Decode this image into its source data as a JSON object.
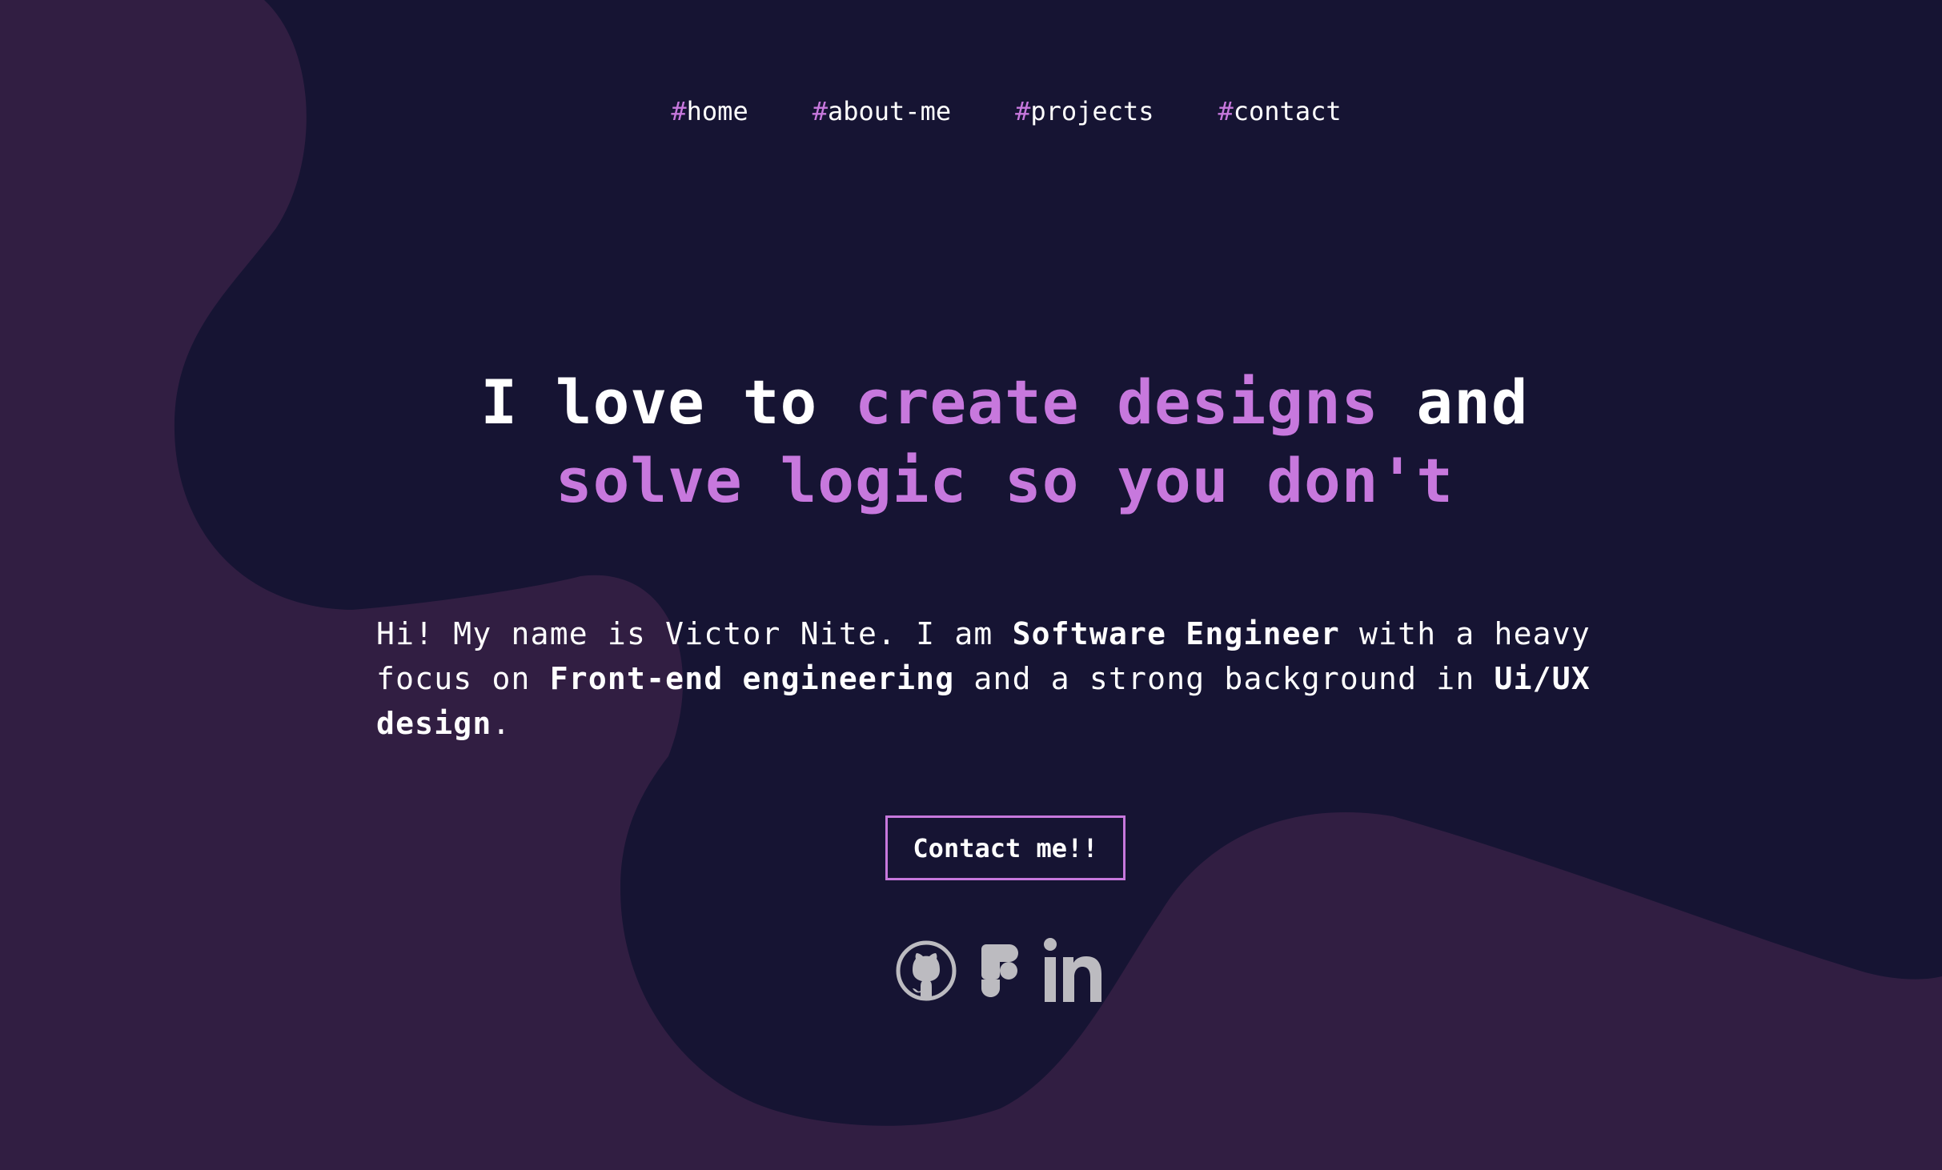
{
  "nav": {
    "items": [
      {
        "hash": "#",
        "label": "home"
      },
      {
        "hash": "#",
        "label": "about-me"
      },
      {
        "hash": "#",
        "label": "projects"
      },
      {
        "hash": "#",
        "label": "contact"
      }
    ]
  },
  "hero": {
    "title_part1": "I love to ",
    "title_accent1": "create designs",
    "title_part2": " and",
    "title_accent2": "solve logic so you don't",
    "desc": {
      "t1": "Hi! My name is Victor Nite. I am ",
      "b1": "Software Engineer",
      "t2": " with a heavy focus on ",
      "b2": "Front-end engineering",
      "t3": " and a strong background in ",
      "b3": "Ui/UX design",
      "t4": "."
    },
    "cta_label": "Contact me!!"
  },
  "socials": [
    {
      "icon": "github-icon"
    },
    {
      "icon": "figma-icon"
    },
    {
      "icon": "linkedin-icon"
    }
  ],
  "colors": {
    "background": "#161433",
    "blob": "#311e42",
    "accent": "#c778dd",
    "text": "#ffffff",
    "icon": "#d9d9d9"
  }
}
